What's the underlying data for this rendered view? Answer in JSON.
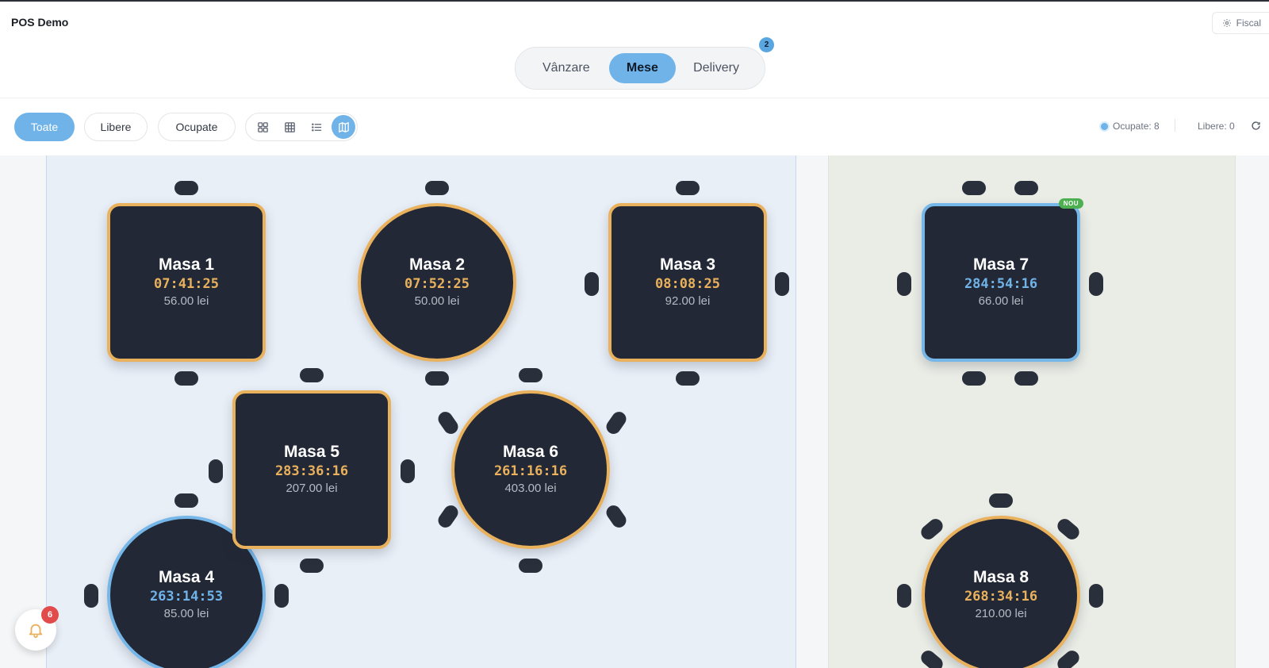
{
  "app": {
    "title": "POS Demo"
  },
  "fiscal": {
    "label": "Fiscal",
    "icon": "gear-icon"
  },
  "mode_tabs": [
    {
      "label": "Vânzare",
      "active": false
    },
    {
      "label": "Mese",
      "active": true
    },
    {
      "label": "Delivery",
      "active": false,
      "badge": "2"
    }
  ],
  "filters": [
    {
      "label": "Toate",
      "active": true
    },
    {
      "label": "Libere",
      "active": false
    },
    {
      "label": "Ocupate",
      "active": false
    }
  ],
  "view_modes": [
    {
      "icon": "grid-small-icon",
      "active": false
    },
    {
      "icon": "grid-large-icon",
      "active": false
    },
    {
      "icon": "list-icon",
      "active": false
    },
    {
      "icon": "map-icon",
      "active": true
    }
  ],
  "stats": {
    "occupied": "Ocupate: 8",
    "free": "Libere: 0"
  },
  "colors": {
    "accent": "#6fb3e8",
    "timer_orange": "#eab15c",
    "table_bg": "#232836",
    "nou": "#4caf50"
  },
  "tables": [
    {
      "name": "Masa 1",
      "time": "07:41:25",
      "amount": "56.00 lei",
      "status": "orange"
    },
    {
      "name": "Masa 2",
      "time": "07:52:25",
      "amount": "50.00 lei",
      "status": "orange"
    },
    {
      "name": "Masa 3",
      "time": "08:08:25",
      "amount": "92.00 lei",
      "status": "orange"
    },
    {
      "name": "Masa 4",
      "time": "263:14:53",
      "amount": "85.00 lei",
      "status": "blue"
    },
    {
      "name": "Masa 5",
      "time": "283:36:16",
      "amount": "207.00 lei",
      "status": "orange"
    },
    {
      "name": "Masa 6",
      "time": "261:16:16",
      "amount": "403.00 lei",
      "status": "orange"
    },
    {
      "name": "Masa 7",
      "time": "284:54:16",
      "amount": "66.00 lei",
      "status": "blue",
      "badge": "NOU"
    },
    {
      "name": "Masa 8",
      "time": "268:34:16",
      "amount": "210.00 lei",
      "status": "orange"
    }
  ],
  "notifications": {
    "count": "6",
    "icon": "bell-icon"
  }
}
